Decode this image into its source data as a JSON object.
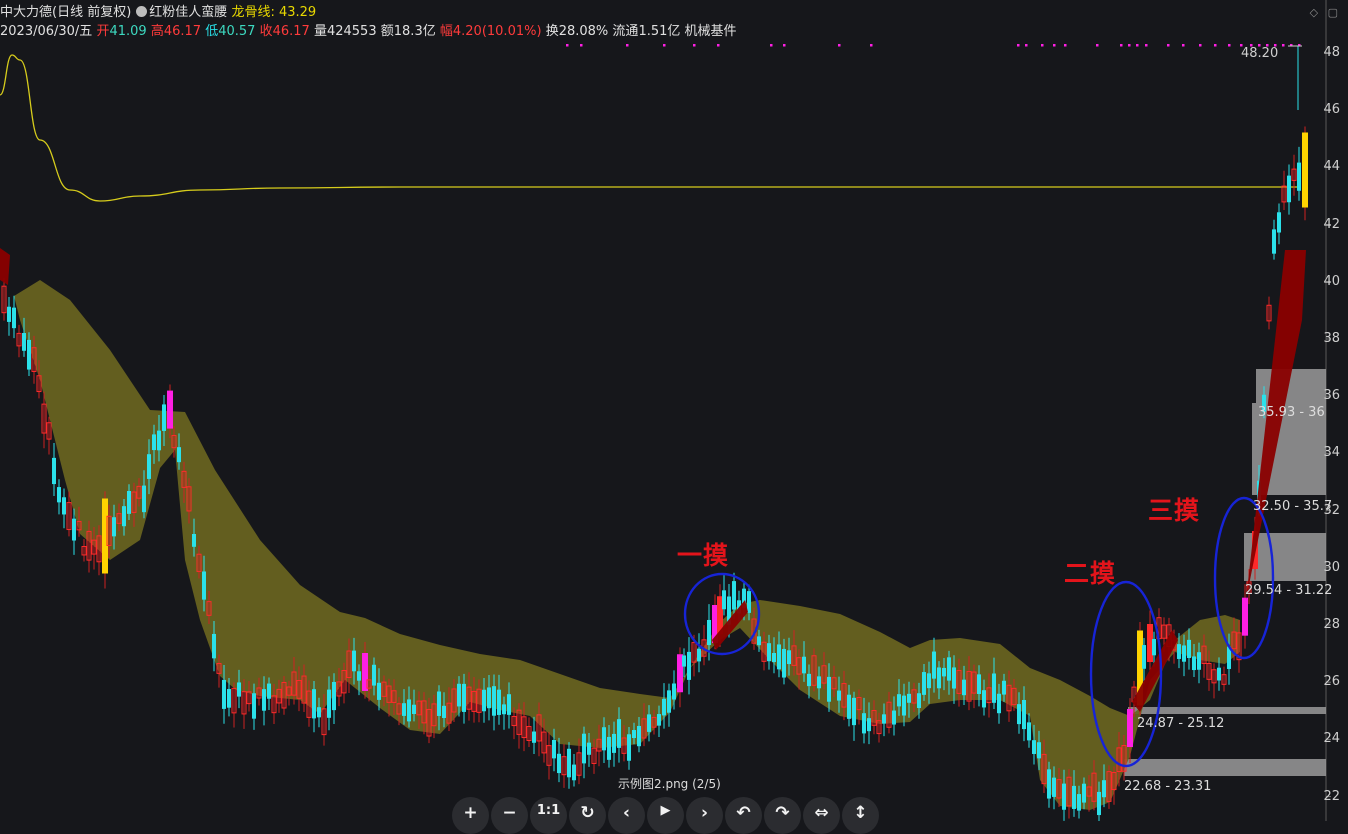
{
  "header": {
    "stock_name": "中大力德(日线 前复权)",
    "indicator_name": "红粉佳人蛮腰",
    "indicator_line_label": "龙骨线:",
    "indicator_line_value": "43.29",
    "date": "2023/06/30/五",
    "open_label": "开",
    "open": "41.09",
    "high_label": "高",
    "high": "46.17",
    "low_label": "低",
    "low": "40.57",
    "close_label": "收",
    "close": "46.17",
    "volume_label": "量",
    "volume": "424553",
    "amount_label": "额",
    "amount": "18.3亿",
    "change_label": "幅",
    "change": "4.20(10.01%)",
    "turnover_label": "换",
    "turnover": "28.08%",
    "float_label": "流通",
    "float_cap": "1.51亿",
    "sector": "机械基件"
  },
  "top_right_icons": [
    "diamond-icon",
    "square-icon"
  ],
  "price_axis": {
    "labels": [
      "48",
      "46",
      "44",
      "42",
      "40",
      "38",
      "36",
      "34",
      "32",
      "30",
      "28",
      "26",
      "24",
      "22"
    ]
  },
  "annotations": {
    "touch1": "一摸",
    "touch2": "二摸",
    "touch3": "三摸"
  },
  "price_marker": "48.20",
  "zones": {
    "z1": "22.68 - 23.31",
    "z2": "24.87 - 25.12",
    "z3": "29.54 - 31.22",
    "z4": "32.50 - 35.7",
    "z5": "35.93 - 36"
  },
  "file_caption": "示例图2.png (2/5)",
  "toolbar": {
    "zoom_in": "+",
    "zoom_out": "−",
    "actual_size": "1:1",
    "refresh": "↻",
    "prev": "‹",
    "play": "▶",
    "next": "›",
    "undo": "↶",
    "redo": "↷",
    "flip_h": "⇔",
    "flip_v": "↕"
  },
  "colors": {
    "background": "#16171b",
    "up_candle": "#ff2a2a",
    "down_candle": "#2be1ea",
    "highlight_candle": "#ff1fe4",
    "limit_up_candle": "#ffd400",
    "band_fill": "#6a6520",
    "dragon_line": "#d6cc1c",
    "circle": "#1724d6",
    "annotation": "#e3141b",
    "zone": "#9a9a9a"
  }
}
